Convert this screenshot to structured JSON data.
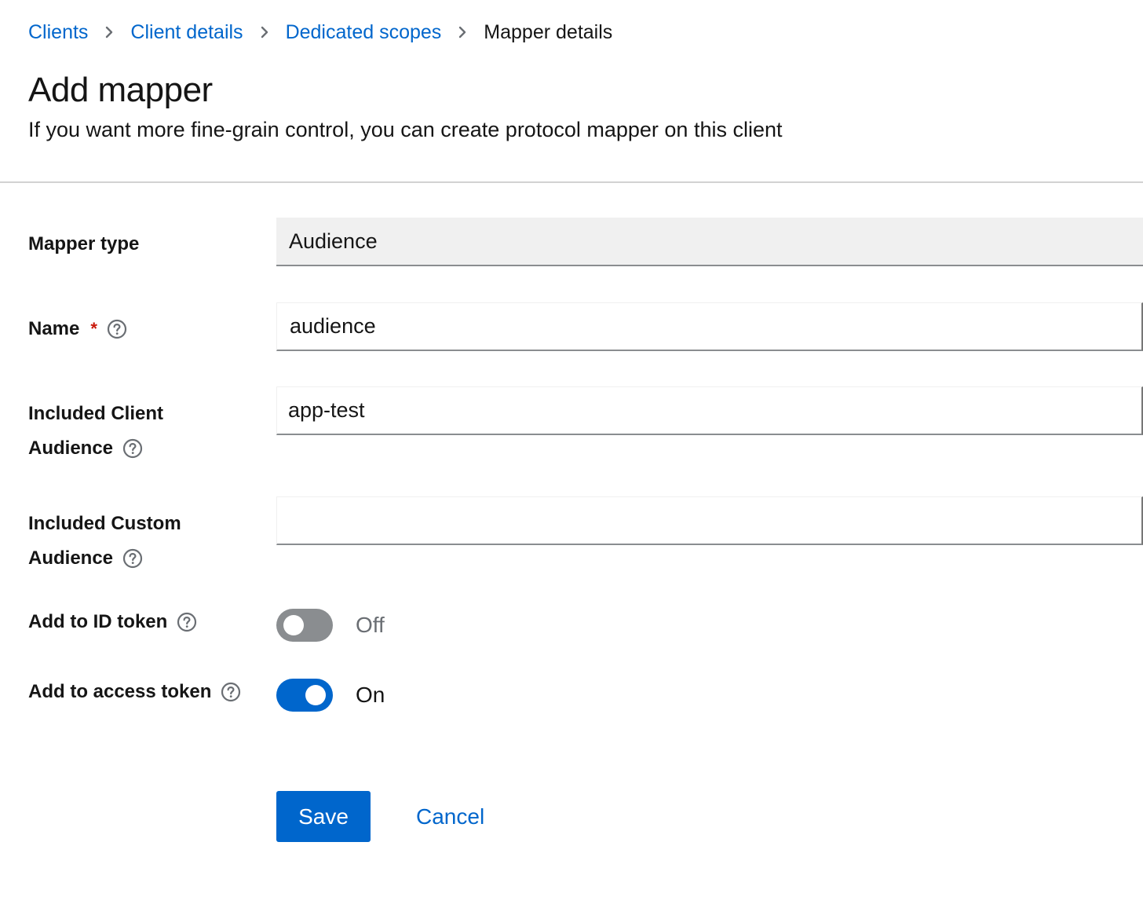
{
  "breadcrumb": {
    "items": [
      {
        "label": "Clients"
      },
      {
        "label": "Client details"
      },
      {
        "label": "Dedicated scopes"
      },
      {
        "label": "Mapper details"
      }
    ]
  },
  "header": {
    "title": "Add mapper",
    "description": "If you want more fine-grain control, you can create protocol mapper on this client"
  },
  "form": {
    "mapper_type": {
      "label": "Mapper type",
      "value": "Audience"
    },
    "name": {
      "label": "Name",
      "required_mark": "*",
      "value": "audience"
    },
    "included_client_audience": {
      "label_line1": "Included Client",
      "label_line2": "Audience",
      "value": "app-test"
    },
    "included_custom_audience": {
      "label_line1": "Included Custom",
      "label_line2": "Audience",
      "value": ""
    },
    "add_to_id_token": {
      "label": "Add to ID token",
      "state": false,
      "state_text": "Off"
    },
    "add_to_access_token": {
      "label": "Add to access token",
      "state": true,
      "state_text": "On"
    }
  },
  "actions": {
    "save_label": "Save",
    "cancel_label": "Cancel"
  },
  "colors": {
    "link": "#0066cc",
    "primary": "#0066cc",
    "required": "#c9190b",
    "switch_off": "#8a8d90",
    "readonly_bg": "#f0f0f0",
    "text": "#151515"
  },
  "icons": {
    "breadcrumb_separator": "chevron-right-icon",
    "help": "question-circle-icon"
  }
}
